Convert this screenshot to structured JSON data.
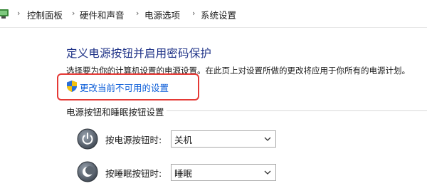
{
  "breadcrumb": {
    "items": [
      "控制面板",
      "硬件和声音",
      "电源选项",
      "系统设置"
    ],
    "separator": "›"
  },
  "page": {
    "title": "定义电源按钮并启用密码保护",
    "description": "选择要为你的计算机设置的电源设置。在此页上对设置所做的更改将应用于你所有的电源计划。",
    "change_link": "更改当前不可用的设置"
  },
  "section": {
    "title": "电源按钮和睡眠按钮设置",
    "rows": [
      {
        "label": "按电源按钮时:",
        "value": "关机",
        "icon": "power-icon"
      },
      {
        "label": "按睡眠按钮时:",
        "value": "睡眠",
        "icon": "sleep-icon"
      }
    ]
  },
  "colors": {
    "title": "#1e3287",
    "link": "#0a5cd8",
    "highlight_box": "#e53935"
  }
}
